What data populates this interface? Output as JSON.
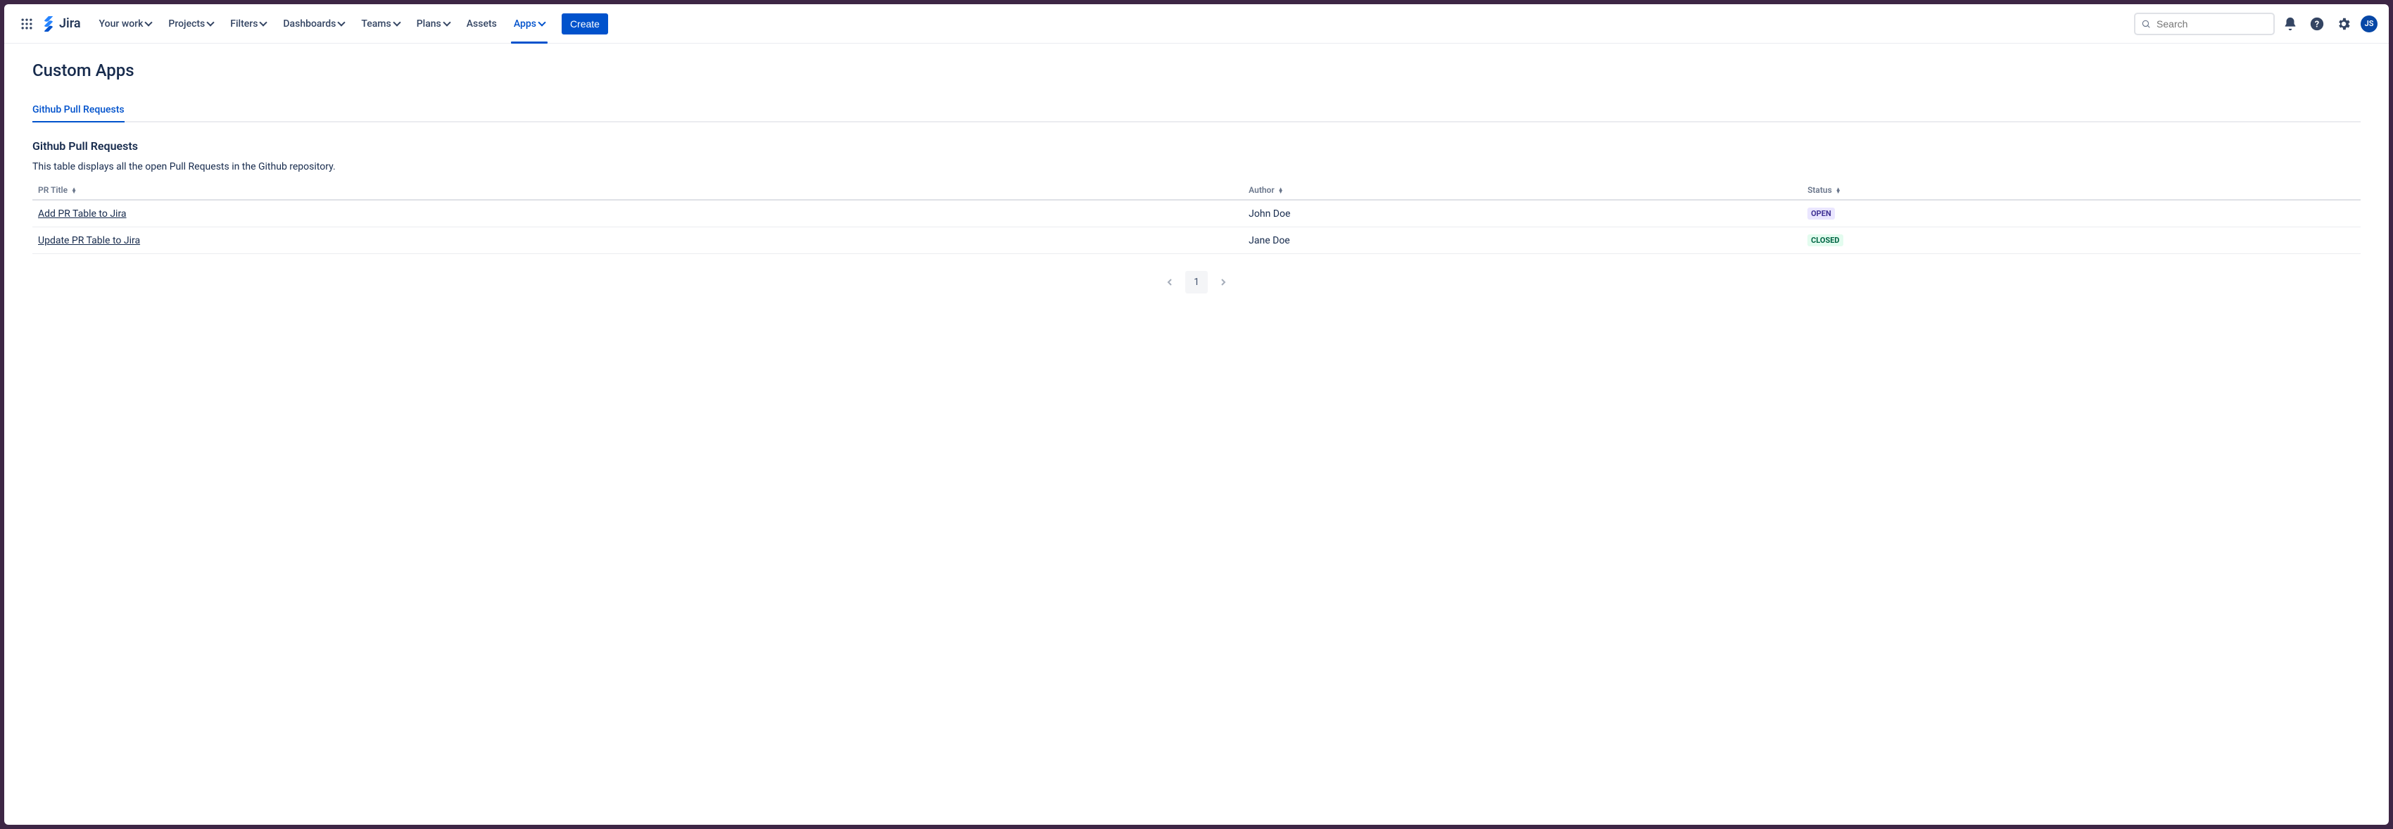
{
  "nav": {
    "product": "Jira",
    "items": [
      {
        "label": "Your work",
        "dropdown": true
      },
      {
        "label": "Projects",
        "dropdown": true
      },
      {
        "label": "Filters",
        "dropdown": true
      },
      {
        "label": "Dashboards",
        "dropdown": true
      },
      {
        "label": "Teams",
        "dropdown": true
      },
      {
        "label": "Plans",
        "dropdown": true
      },
      {
        "label": "Assets",
        "dropdown": false
      },
      {
        "label": "Apps",
        "dropdown": true,
        "active": true
      }
    ],
    "create_label": "Create",
    "search_placeholder": "Search",
    "avatar_initials": "JS"
  },
  "page": {
    "title": "Custom Apps",
    "tabs": [
      {
        "label": "Github Pull Requests",
        "active": true
      }
    ],
    "section_title": "Github Pull Requests",
    "section_desc": "This table displays all the open Pull Requests in the Github repository."
  },
  "table": {
    "columns": [
      "PR Title",
      "Author",
      "Status"
    ],
    "rows": [
      {
        "title": "Add PR Table to Jira",
        "author": "John Doe",
        "status": "OPEN",
        "status_kind": "open"
      },
      {
        "title": "Update PR Table to Jira",
        "author": "Jane Doe",
        "status": "CLOSED",
        "status_kind": "closed"
      }
    ]
  },
  "pagination": {
    "current": "1"
  }
}
